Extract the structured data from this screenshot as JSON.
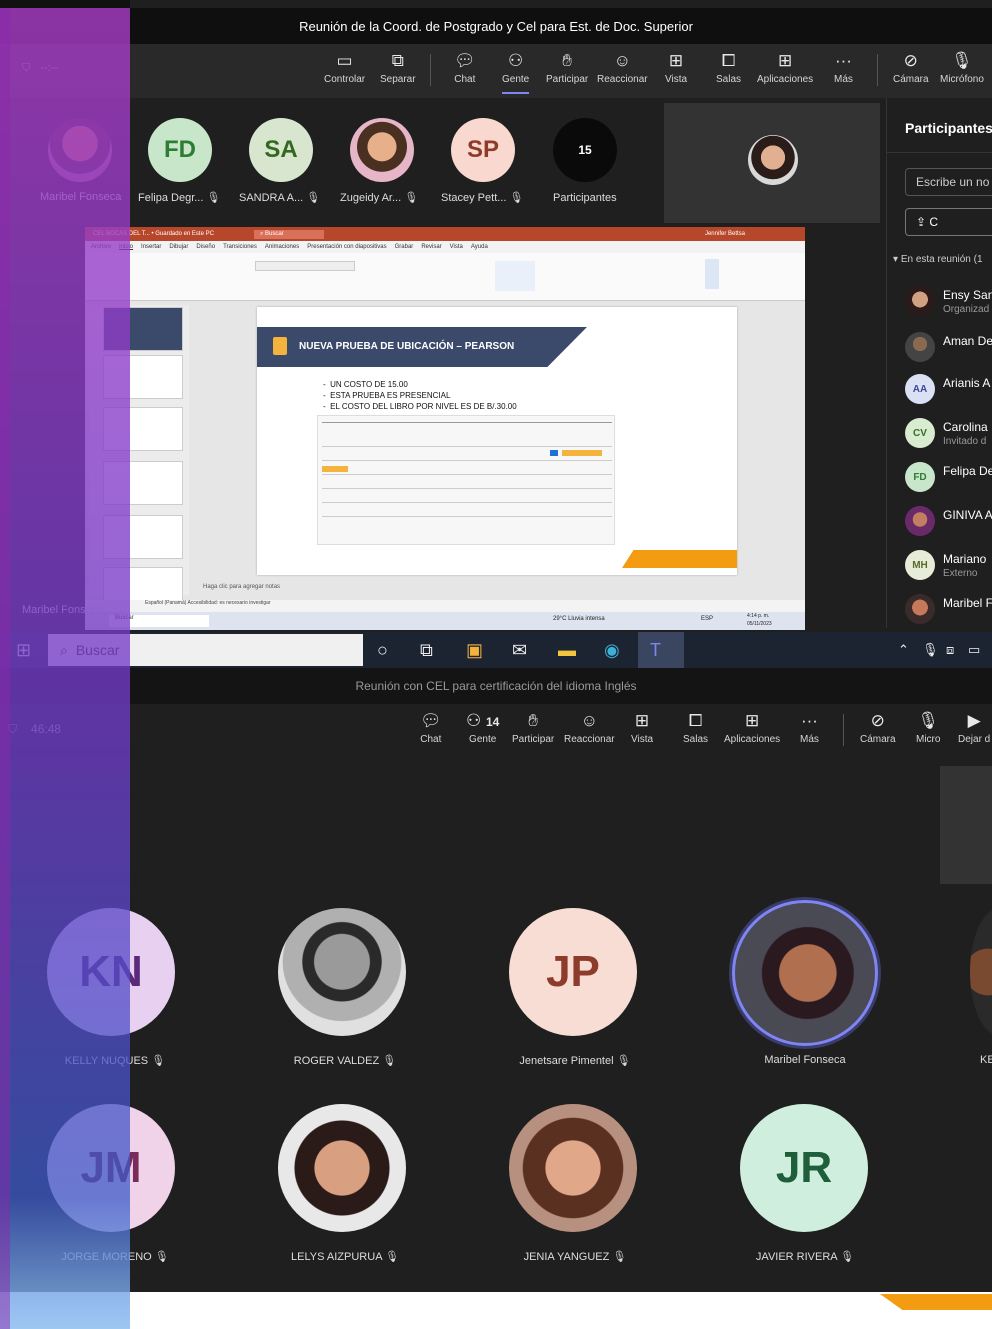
{
  "meeting1": {
    "title": "Reunión de la Coord. de Postgrado y Cel para Est. de Doc. Superior",
    "timer": "--:--",
    "toolbar": [
      {
        "label": "Controlar",
        "icon": "control-icon"
      },
      {
        "label": "Separar",
        "icon": "popout-icon"
      },
      {
        "label": "Chat",
        "icon": "chat-icon"
      },
      {
        "label": "Gente",
        "icon": "people-icon"
      },
      {
        "label": "Participar",
        "icon": "raise-hand-icon"
      },
      {
        "label": "Reaccionar",
        "icon": "react-icon"
      },
      {
        "label": "Vista",
        "icon": "view-icon"
      },
      {
        "label": "Salas",
        "icon": "rooms-icon"
      },
      {
        "label": "Aplicaciones",
        "icon": "apps-icon"
      },
      {
        "label": "Más",
        "icon": "more-icon"
      },
      {
        "label": "Cámara",
        "icon": "camera-off-icon"
      },
      {
        "label": "Micrófono",
        "icon": "mic-off-icon"
      }
    ],
    "participants_strip": [
      {
        "name": "Maribel Fonseca",
        "type": "photo"
      },
      {
        "initials": "FD",
        "name": "Felipa Degr...",
        "color": "#c8e6c9",
        "text": "#2e7d32"
      },
      {
        "initials": "SA",
        "name": "SANDRA A...",
        "color": "#d8e6d0",
        "text": "#33691e"
      },
      {
        "name": "Zugeidy Ar...",
        "type": "photo"
      },
      {
        "initials": "SP",
        "name": "Stacey Pett...",
        "color": "#f8d8cf",
        "text": "#8d3b2b"
      },
      {
        "count": "15",
        "name": "Participantes"
      }
    ],
    "panel": {
      "title": "Participantes",
      "search_placeholder": "Escribe un no",
      "share_label": "C",
      "section": "En esta reunión (1",
      "people": [
        {
          "name": "Ensy San",
          "role": "Organizad",
          "type": "photo"
        },
        {
          "name": "Aman De",
          "role": "",
          "type": "photo"
        },
        {
          "name": "Arianis A",
          "role": "",
          "initials": "AA"
        },
        {
          "name": "Carolina",
          "role": "Invitado d",
          "initials": "CV"
        },
        {
          "name": "Felipa De",
          "role": "",
          "initials": "FD"
        },
        {
          "name": "GINIVA A",
          "role": "",
          "type": "photo"
        },
        {
          "name": "Mariano",
          "role": "Externo",
          "initials": "MH"
        },
        {
          "name": "Maribel F",
          "role": "",
          "type": "photo"
        }
      ]
    },
    "shared_label": "Maribel Fonseca",
    "slide": {
      "title": "NUEVA PRUEBA DE UBICACIÓN – PEARSON",
      "bullets": [
        "UN COSTO DE 15.00",
        "ESTA PRUEBA ES PRESENCIAL",
        "EL COSTO DEL LIBRO POR NIVEL ES DE B/.30.00"
      ],
      "notes": "Haga clic para agregar notas"
    },
    "ppt": {
      "filename": "CEL  BOCAS DEL T... • Guardado en Este PC",
      "search": "Buscar",
      "user": "Jennifer Bettsa",
      "menu": [
        "Archivo",
        "Inicio",
        "Insertar",
        "Dibujar",
        "Diseño",
        "Transiciones",
        "Animaciones",
        "Presentación con diapositivas",
        "Grabar",
        "Revisar",
        "Vista",
        "Ayuda"
      ],
      "status": "Español (Panamá)   Accesibilidad: es necesario investigar",
      "weather": "29°C  Lluvia intensa",
      "time": "4:14 p. m.",
      "date": "05/11/2023",
      "lang": "ESP"
    }
  },
  "taskbar": {
    "search_label": "Buscar"
  },
  "meeting2": {
    "title": "Reunión con CEL para certificación del idioma Inglés",
    "timer": "46:48",
    "people_count": "14",
    "toolbar": [
      {
        "label": "Chat",
        "icon": "chat-icon"
      },
      {
        "label": "Gente",
        "icon": "people-icon"
      },
      {
        "label": "Participar",
        "icon": "raise-hand-icon"
      },
      {
        "label": "Reaccionar",
        "icon": "react-icon"
      },
      {
        "label": "Vista",
        "icon": "view-icon"
      },
      {
        "label": "Salas",
        "icon": "rooms-icon"
      },
      {
        "label": "Aplicaciones",
        "icon": "apps-icon"
      },
      {
        "label": "Más",
        "icon": "more-icon"
      },
      {
        "label": "Cámara",
        "icon": "camera-off-icon"
      },
      {
        "label": "Micro",
        "icon": "mic-icon"
      },
      {
        "label": "Dejar d",
        "icon": "leave-icon"
      }
    ],
    "tiles": [
      {
        "initials": "KN",
        "name": "KELLY NUQUES",
        "color": "#e8d0f0",
        "text": "#5a2a7a"
      },
      {
        "name": "ROGER VALDEZ",
        "type": "photo"
      },
      {
        "initials": "JP",
        "name": "Jenetsare Pimentel",
        "color": "#f7ddd3",
        "text": "#8d3b2b"
      },
      {
        "name": "Maribel Fonseca",
        "type": "photo",
        "speaking": true
      },
      {
        "name": "KE",
        "type": "partial"
      },
      {
        "initials": "JM",
        "name": "JORGE MORENO",
        "color": "#f0d3e8",
        "text": "#7a2a5a"
      },
      {
        "name": "LELYS AIZPURUA",
        "type": "photo"
      },
      {
        "name": "JENIA YANGUEZ",
        "type": "photo"
      },
      {
        "initials": "JR",
        "name": "JAVIER RIVERA",
        "color": "#cfeedd",
        "text": "#1e5e3a"
      }
    ]
  },
  "colors": {
    "accent": "#7f85f5",
    "teams_bg": "#1f1f1f",
    "ppt_red": "#b7472a",
    "slide_orange": "#f39c12",
    "slide_navy": "#3b4a6b"
  }
}
